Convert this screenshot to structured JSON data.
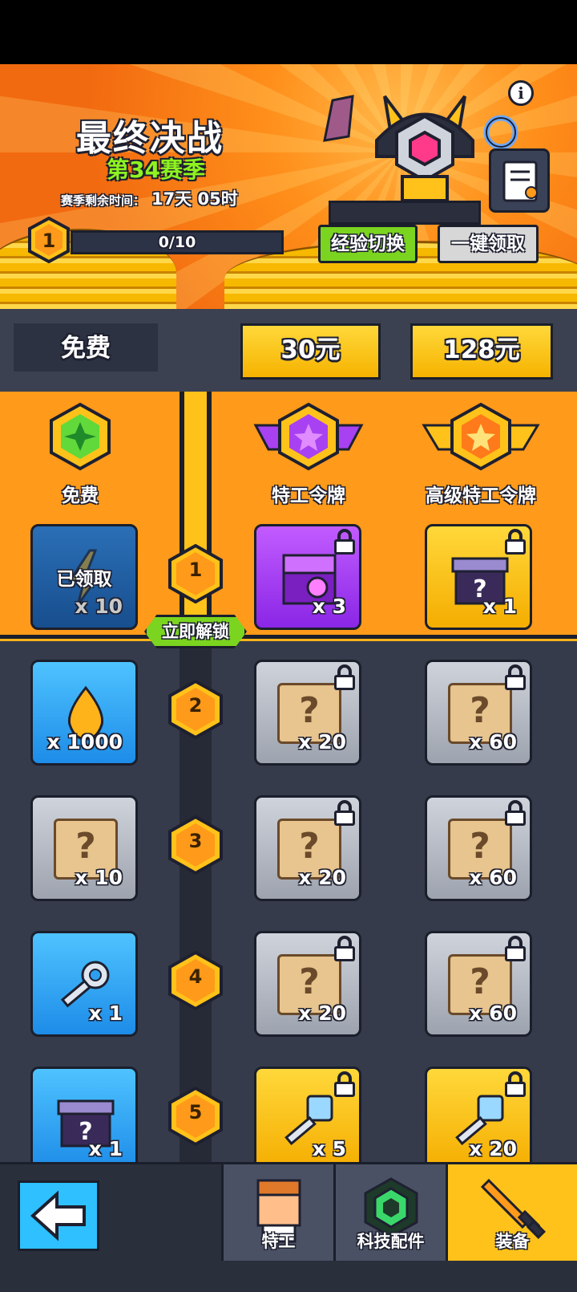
{
  "header": {
    "title": "最终决战",
    "season": "第34赛季",
    "remaining_label": "赛季剩余时间：",
    "remaining_value": "17天 05时",
    "level": "1",
    "progress_text": "0/10",
    "progress_fraction": 0,
    "exp_switch_label": "经验切换",
    "claim_all_label": "一键领取"
  },
  "tiers": {
    "free": "免费",
    "tier1": "30元",
    "tier2": "128元"
  },
  "columns": {
    "free": "免费",
    "agent": "特工令牌",
    "premium": "高级特工令牌"
  },
  "unlock_label": "立即解锁",
  "rows": [
    {
      "level": "1",
      "free": {
        "label": "已领取",
        "qty": "x 10"
      },
      "agent": {
        "qty": "x 3"
      },
      "premium": {
        "qty": "x 1"
      }
    },
    {
      "level": "2",
      "free": {
        "qty": "x 1000"
      },
      "agent": {
        "qty": "x 20"
      },
      "premium": {
        "qty": "x 60"
      }
    },
    {
      "level": "3",
      "free": {
        "qty": "x 10"
      },
      "agent": {
        "qty": "x 20"
      },
      "premium": {
        "qty": "x 60"
      }
    },
    {
      "level": "4",
      "free": {
        "qty": "x 1"
      },
      "agent": {
        "qty": "x 20"
      },
      "premium": {
        "qty": "x 60"
      }
    },
    {
      "level": "5",
      "free": {
        "qty": "x 1"
      },
      "agent": {
        "qty": "x 5"
      },
      "premium": {
        "qty": "x 20"
      }
    }
  ],
  "nav": {
    "agent": "特工",
    "tech": "科技配件",
    "equip": "装备"
  },
  "icons": [
    "info-icon",
    "rewards-scroll-icon",
    "back-arrow-icon",
    "lock-icon",
    "energy-bolt-icon",
    "chest-icon",
    "mystery-box-icon",
    "gold-drop-icon",
    "blueprint-scroll-icon",
    "key-icon",
    "diamond-key-icon",
    "green-gem-badge-icon",
    "purple-star-badge-icon",
    "orange-star-badge-icon",
    "agent-avatar-icon",
    "tech-chip-icon",
    "sword-icon"
  ],
  "colors": {
    "orange": "#ff9a1a",
    "gold": "#ffc21a",
    "green": "#7bd41f",
    "dark": "#353b4b",
    "blue": "#2ec0ff",
    "purple": "#a841f2"
  }
}
